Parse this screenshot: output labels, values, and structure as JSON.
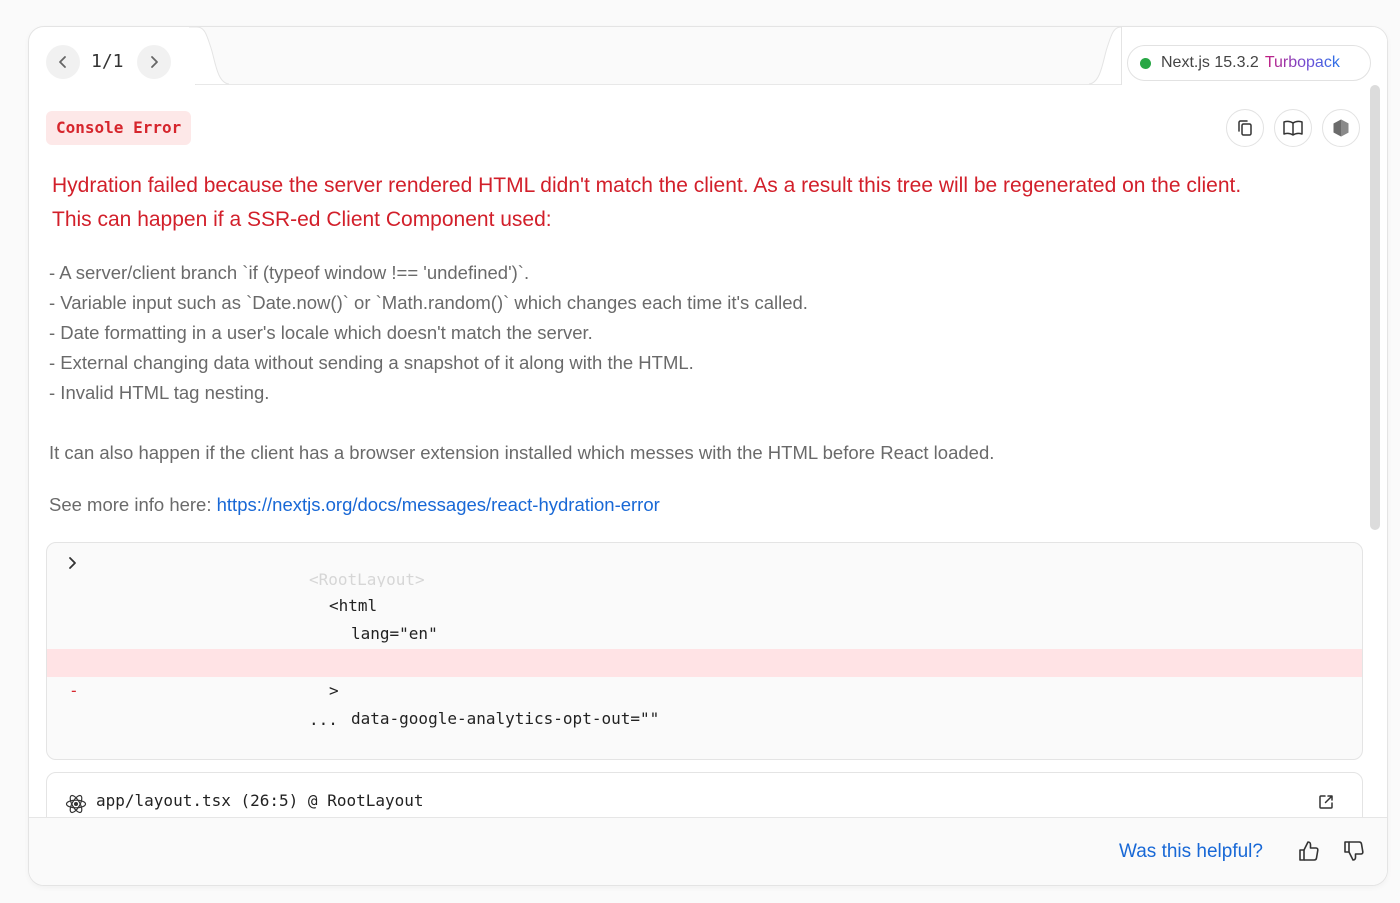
{
  "pager": {
    "counter": "1/1"
  },
  "version": {
    "label": "Next.js 15.3.2",
    "bundler": "Turbopack",
    "status_color": "#28a745"
  },
  "error": {
    "badge": "Console Error",
    "title_line1": "Hydration failed because the server rendered HTML didn't match the client. As a result this tree will be regenerated on the client.",
    "title_line2": "This can happen if a SSR-ed Client Component used:",
    "bullets": [
      "- A server/client branch `if (typeof window !== 'undefined')`.",
      "- Variable input such as `Date.now()` or `Math.random()` which changes each time it's called.",
      "- Date formatting in a user's locale which doesn't match the server.",
      "- External changing data without sending a snapshot of it along with the HTML.",
      "- Invalid HTML tag nesting."
    ],
    "extension_note": "It can also happen if the client has a browser extension installed which messes with the HTML before React loaded.",
    "more_info_prefix": "See more info here: ",
    "more_info_link": "https://nextjs.org/docs/messages/react-hydration-error"
  },
  "diff": {
    "faded_line": "<RootLayout>",
    "lines": [
      "<html",
      "lang=\"en\"",
      "data-google-analytics-opt-out=\"\"",
      ">",
      "..."
    ],
    "removed_marker": "-"
  },
  "source": {
    "location": "app/layout.tsx (26:5) @ RootLayout"
  },
  "footer": {
    "helpful": "Was this helpful?"
  },
  "icons": {
    "prev": "chevron-left-icon",
    "next": "chevron-right-icon",
    "copy": "copy-icon",
    "docs": "book-icon",
    "devtools": "hexagon-icon",
    "react": "react-icon",
    "open": "external-link-icon",
    "up": "thumbs-up-icon",
    "down": "thumbs-down-icon"
  }
}
